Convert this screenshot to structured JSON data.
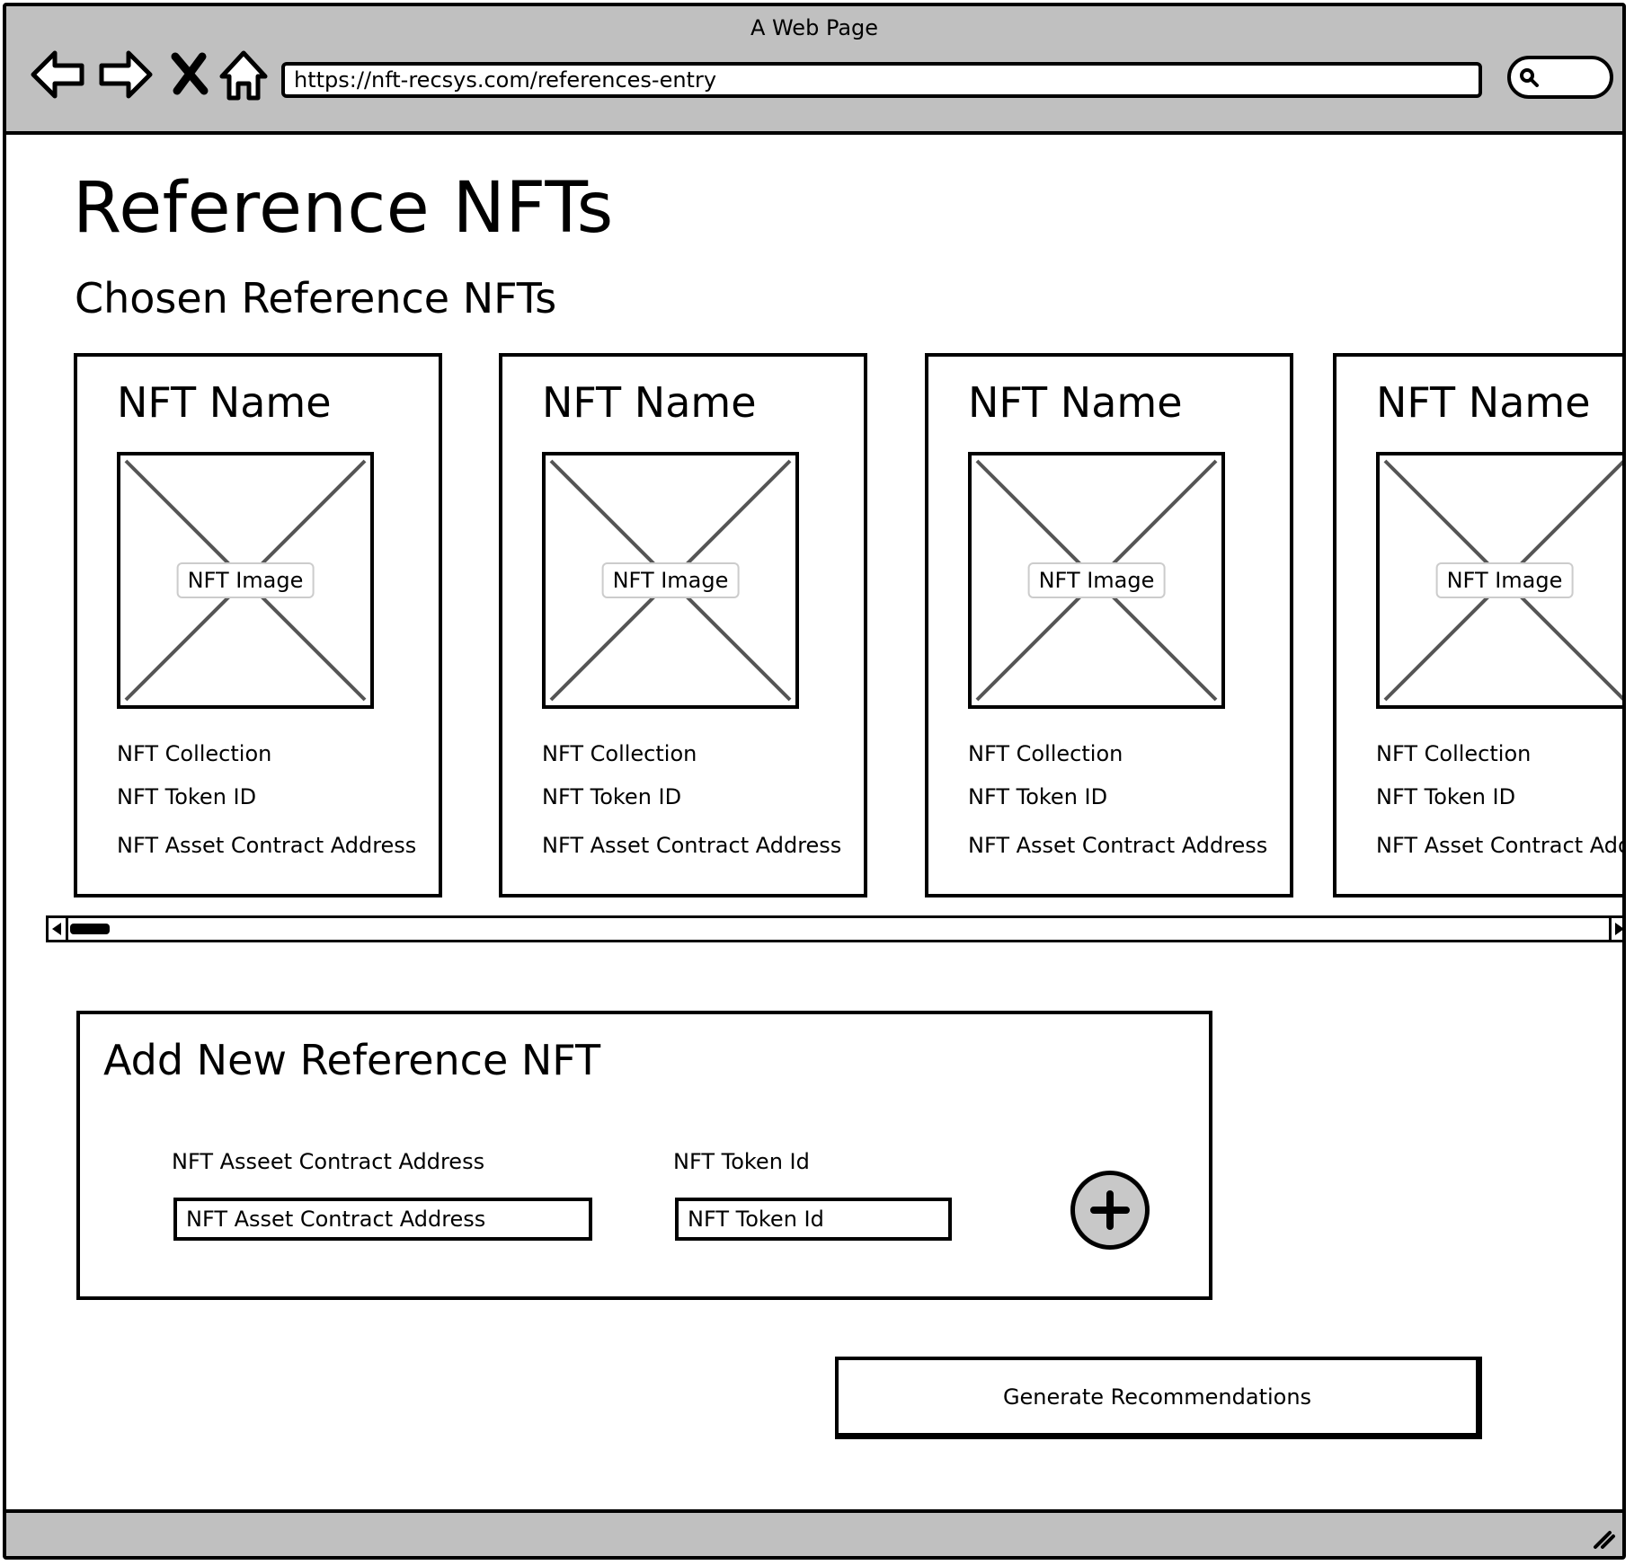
{
  "window": {
    "title": "A Web Page",
    "url": "https://nft-recsys.com/references-entry"
  },
  "toolbar_icons": [
    "back-arrow-icon",
    "forward-arrow-icon",
    "close-x-icon",
    "home-icon",
    "search-icon"
  ],
  "page": {
    "title": "Reference NFTs",
    "section_title": "Chosen Reference NFTs"
  },
  "cards": [
    {
      "name": "NFT Name",
      "image_label": "NFT Image",
      "collection": "NFT Collection",
      "token_id": "NFT Token ID",
      "contract": "NFT Asset Contract Address"
    },
    {
      "name": "NFT Name",
      "image_label": "NFT Image",
      "collection": "NFT Collection",
      "token_id": "NFT Token ID",
      "contract": "NFT Asset Contract Address"
    },
    {
      "name": "NFT Name",
      "image_label": "NFT Image",
      "collection": "NFT Collection",
      "token_id": "NFT Token ID",
      "contract": "NFT Asset Contract Address"
    },
    {
      "name": "NFT Name",
      "image_label": "NFT Image",
      "collection": "NFT Collection",
      "token_id": "NFT Token ID",
      "contract": "NFT Asset Contract Add"
    }
  ],
  "add_form": {
    "title": "Add New Reference NFT",
    "contract_label": "NFT Asseet Contract Address",
    "contract_placeholder": "NFT Asset Contract Address",
    "token_label": "NFT Token Id",
    "token_placeholder": "NFT Token Id",
    "add_icon": "plus-icon"
  },
  "actions": {
    "generate_label": "Generate Recommendations"
  },
  "colors": {
    "chrome": "#c0c0c0",
    "border": "#000000",
    "image_placeholder_lines": "#555555",
    "add_button_fill": "#c8c8c8"
  }
}
